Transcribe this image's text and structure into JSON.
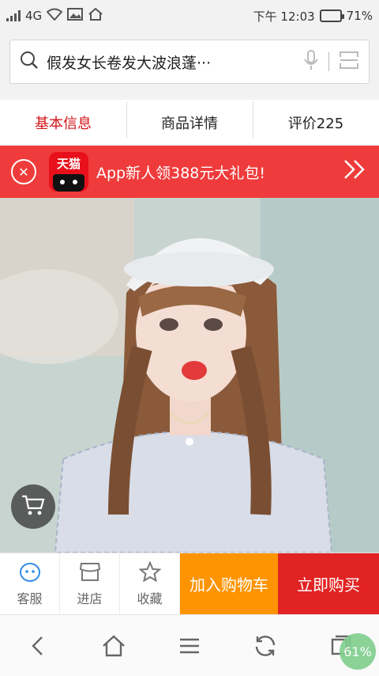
{
  "status_bar": {
    "network": "4G",
    "time": "下午 12:03",
    "battery_percent": "71%",
    "battery_level": 0.71
  },
  "search": {
    "query": "假发女长卷发大波浪蓬···"
  },
  "tabs": [
    {
      "label": "基本信息",
      "active": true
    },
    {
      "label": "商品详情",
      "active": false
    },
    {
      "label": "评价225",
      "active": false
    }
  ],
  "banner": {
    "logo_text": "天猫",
    "promo_text": "App新人领388元大礼包!",
    "accent": "#ef3b3b"
  },
  "actions": {
    "service": "客服",
    "store": "进店",
    "favorite": "收藏",
    "add_to_cart": "加入购物车",
    "buy_now": "立即购买"
  },
  "browser": {
    "progress": "61%"
  },
  "colors": {
    "active_tab": "#d4151b",
    "cart_button": "#ff9402",
    "buy_button": "#e22323"
  }
}
